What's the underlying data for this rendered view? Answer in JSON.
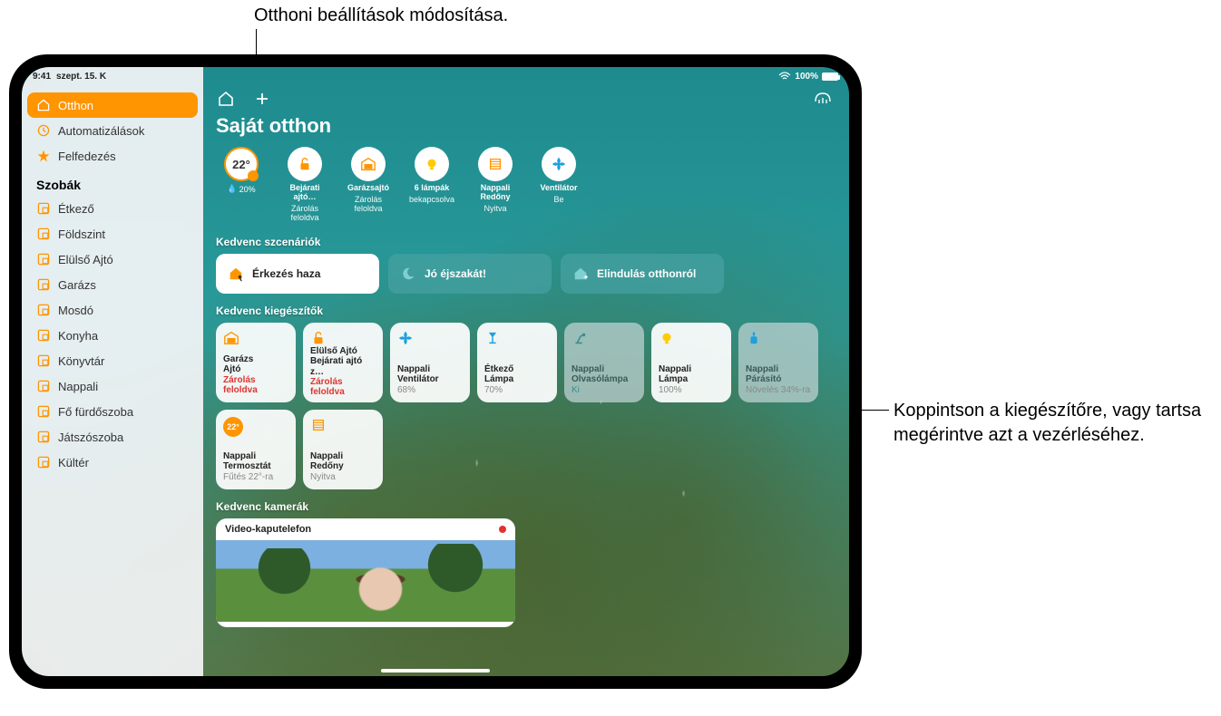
{
  "callouts": {
    "top": "Otthoni beállítások módosítása.",
    "right": "Koppintson a kiegészítőre, vagy tartsa megérintve azt a vezérléséhez."
  },
  "statusbar": {
    "time": "9:41",
    "date": "szept. 15. K",
    "battery": "100%"
  },
  "sidebar": {
    "nav": [
      {
        "label": "Otthon",
        "icon": "house-icon",
        "active": true
      },
      {
        "label": "Automatizálások",
        "icon": "clock-icon",
        "active": false
      },
      {
        "label": "Felfedezés",
        "icon": "star-icon",
        "active": false
      }
    ],
    "rooms_header": "Szobák",
    "rooms": [
      "Étkező",
      "Földszint",
      "Elülső Ajtó",
      "Garázs",
      "Mosdó",
      "Konyha",
      "Könyvtár",
      "Nappali",
      "Fő fürdőszoba",
      "Játszószoba",
      "Kültér"
    ]
  },
  "header": {
    "title": "Saját otthon"
  },
  "status_chips": {
    "temp": {
      "value": "22°",
      "rain": "20%"
    },
    "items": [
      {
        "line1": "Bejárati ajtó…",
        "line2": "Zárolás feloldva",
        "icon": "lock-open-icon"
      },
      {
        "line1": "Garázsajtó",
        "line2": "Zárolás feloldva",
        "icon": "garage-icon"
      },
      {
        "line1": "6 lámpák",
        "line2": "bekapcsolva",
        "icon": "bulb-icon"
      },
      {
        "line1": "Nappali Redőny",
        "line2": "Nyitva",
        "icon": "blinds-icon"
      },
      {
        "line1": "Ventilátor",
        "line2": "Be",
        "icon": "fan-icon"
      }
    ]
  },
  "scenes": {
    "header": "Kedvenc szcenáriók",
    "items": [
      {
        "label": "Érkezés haza",
        "style": "white",
        "icon": "home-person-icon",
        "iconColor": "#ff9500"
      },
      {
        "label": "Jó éjszakát!",
        "style": "teal",
        "icon": "moon-icon",
        "iconColor": "#7fd0d0"
      },
      {
        "label": "Elindulás otthonról",
        "style": "teal",
        "icon": "home-leave-icon",
        "iconColor": "#7fd0d0"
      }
    ]
  },
  "accessories": {
    "header": "Kedvenc kiegészítők",
    "items": [
      {
        "line1": "Garázs",
        "line2": "Ajtó",
        "value": "Zárolás feloldva",
        "valClass": "red",
        "icon": "garage-icon",
        "iconColor": "#ff9500"
      },
      {
        "line1": "Elülső Ajtó",
        "line2": "Bejárati ajtó z…",
        "value": "Zárolás feloldva",
        "valClass": "red",
        "icon": "lock-open-icon",
        "iconColor": "#ff9500"
      },
      {
        "line1": "Nappali",
        "line2": "Ventilátor",
        "value": "68%",
        "valClass": "",
        "icon": "fan-icon",
        "iconColor": "#1ea0e0"
      },
      {
        "line1": "Étkező",
        "line2": "Lámpa",
        "value": "70%",
        "valClass": "",
        "icon": "floor-lamp-icon",
        "iconColor": "#1ea0e0"
      },
      {
        "line1": "Nappali",
        "line2": "Olvasólámpa",
        "value": "Ki",
        "valClass": "teal",
        "dim": true,
        "icon": "desk-lamp-icon",
        "iconColor": "#3a8f8f"
      },
      {
        "line1": "Nappali",
        "line2": "Lámpa",
        "value": "100%",
        "valClass": "",
        "icon": "bulb-icon",
        "iconColor": "#ffcc00"
      },
      {
        "line1": "Nappali",
        "line2": "Párásító",
        "value": "Növelés 34%-ra",
        "valClass": "",
        "dim": true,
        "icon": "humidifier-icon",
        "iconColor": "#1ea0e0"
      },
      {
        "line1": "Nappali",
        "line2": "Termosztát",
        "value": "Fűtés 22°-ra",
        "valClass": "",
        "icon": "thermostat-icon"
      },
      {
        "line1": "Nappali",
        "line2": "Redőny",
        "value": "Nyitva",
        "valClass": "",
        "icon": "blinds-icon",
        "iconColor": "#ff9500"
      }
    ]
  },
  "cameras": {
    "header": "Kedvenc kamerák",
    "title": "Video-kaputelefon"
  }
}
